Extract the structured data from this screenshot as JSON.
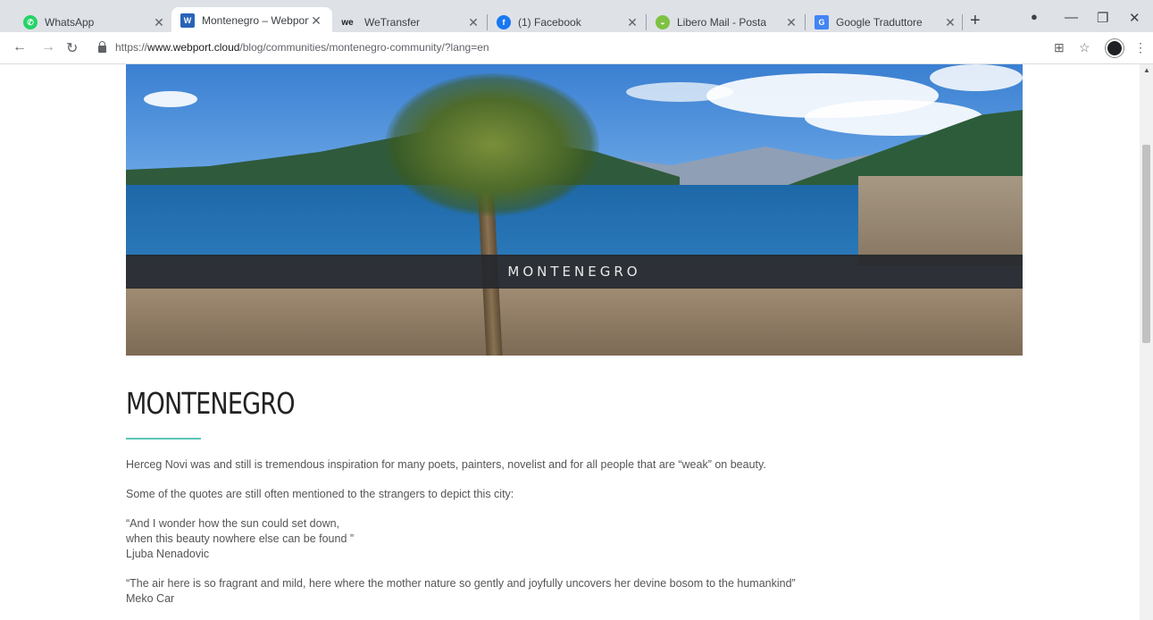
{
  "browser": {
    "tabs": [
      {
        "title": "WhatsApp",
        "favicon": "whatsapp-icon",
        "color": "#25d366",
        "glyph": "✆",
        "active": false
      },
      {
        "title": "Montenegro – Webport",
        "favicon": "webport-icon",
        "color": "#2a63b8",
        "glyph": "W",
        "active": true
      },
      {
        "title": "WeTransfer",
        "favicon": "wetransfer-icon",
        "color": "#202124",
        "glyph": "we",
        "active": false
      },
      {
        "title": "(1) Facebook",
        "favicon": "facebook-icon",
        "color": "#1877f2",
        "glyph": "f",
        "active": false
      },
      {
        "title": "Libero Mail - Posta",
        "favicon": "libero-icon",
        "color": "#7dc242",
        "glyph": "◒",
        "active": false
      },
      {
        "title": "Google Traduttore",
        "favicon": "google-translate-icon",
        "color": "#4285f4",
        "glyph": "G",
        "active": false
      }
    ],
    "close_glyph": "✕",
    "new_tab_glyph": "+",
    "url": {
      "scheme": "https://",
      "host": "www.webport.cloud",
      "path": "/blog/communities/montenegro-community/?lang=en"
    }
  },
  "hero": {
    "banner_text": "MONTENEGRO"
  },
  "article": {
    "title": "MONTENEGRO",
    "paragraphs": [
      "Herceg  Novi was and still is tremendous inspiration for many poets, painters, novelist and for all people that are “weak” on beauty.",
      "Some of the  quotes  are still often mentioned to the strangers to depict this city:"
    ],
    "quote1": {
      "lines": [
        "“And I wonder how the sun could  set down,",
        "when this beauty nowhere else can be found ”",
        "Ljuba Nenadovic"
      ]
    },
    "quote2": {
      "lines": [
        "“The air here is so fragrant and mild, here  where the mother nature so gently and joyfully uncovers her devine bosom to the humankind”",
        "Meko Car"
      ]
    }
  },
  "colors": {
    "accent": "#5bc5b7",
    "banner": "#26292d",
    "tabstrip": "#dee1e6"
  }
}
